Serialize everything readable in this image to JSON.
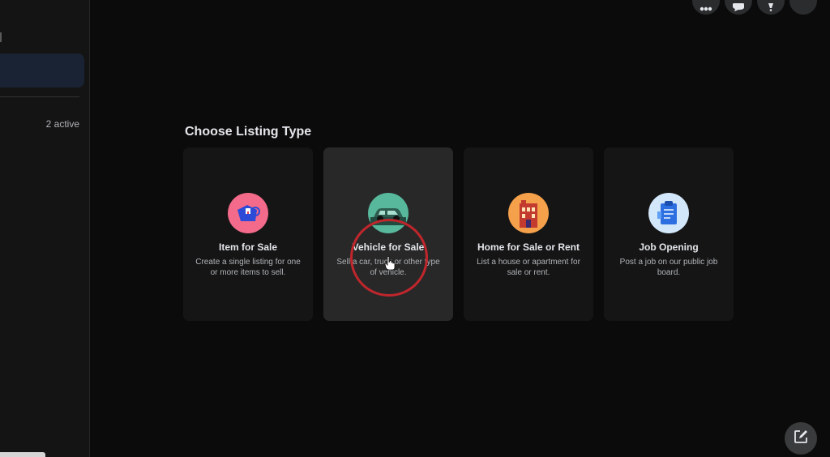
{
  "sidebar": {
    "active_count": "2 active"
  },
  "heading": "Choose Listing Type",
  "top_icons": [
    "menu-grid-icon",
    "messenger-icon",
    "notification-icon",
    "account-icon"
  ],
  "cards": [
    {
      "title": "Item for Sale",
      "description": "Create a single listing for one or more items to sell.",
      "icon": "tag-icon",
      "icon_bg": "#f46a8a"
    },
    {
      "title": "Vehicle for Sale",
      "description": "Sell a car, truck or other type of vehicle.",
      "icon": "car-icon",
      "icon_bg": "#57b89b"
    },
    {
      "title": "Home for Sale or Rent",
      "description": "List a house or apartment for sale or rent.",
      "icon": "house-icon",
      "icon_bg": "#f5a04a"
    },
    {
      "title": "Job Opening",
      "description": "Post a job on our public job board.",
      "icon": "clipboard-icon",
      "icon_bg": "#d3e7fb"
    }
  ],
  "fab": {
    "icon": "compose-icon"
  },
  "colors": {
    "page_bg": "#0b0b0b",
    "card_bg": "#151515",
    "card_hover_bg": "#282828",
    "click_ring": "#c0262c"
  }
}
